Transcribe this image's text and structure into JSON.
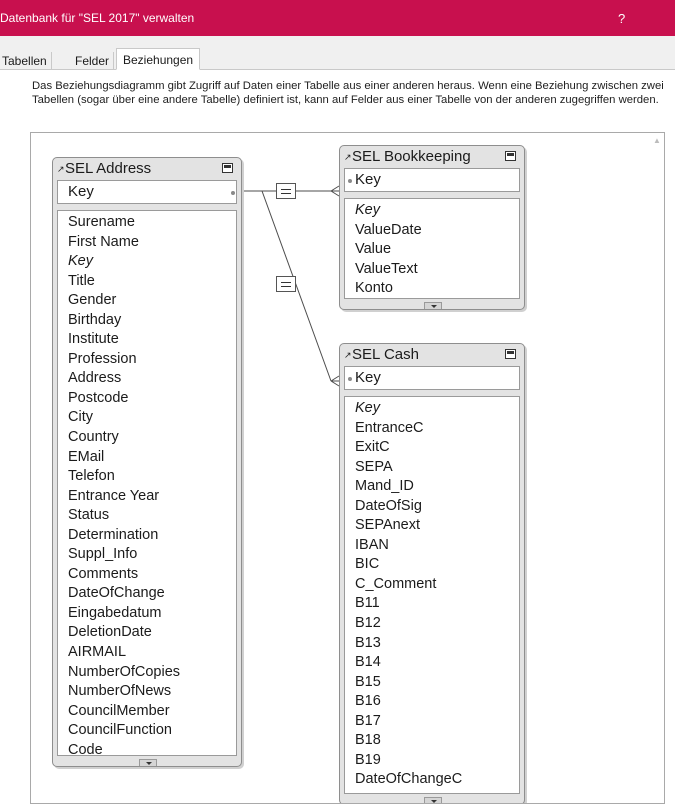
{
  "window": {
    "title": "Datenbank für \"SEL 2017\" verwalten",
    "help_label": "?"
  },
  "tabs": [
    {
      "label": "Tabellen"
    },
    {
      "label": "Felder"
    },
    {
      "label": "Beziehungen",
      "active": true
    }
  ],
  "description": "Das Beziehungsdiagramm gibt Zugriff auf Daten einer Tabelle aus einer anderen heraus. Wenn eine Beziehung zwischen zwei Tabellen (sogar über eine andere Tabelle) definiert ist, kann auf Felder aus einer Tabelle von der anderen zugegriffen werden.",
  "tables": {
    "address": {
      "name": "SEL Address",
      "key_field": "Key",
      "fields": [
        "Surename",
        "First Name",
        "Key",
        "Title",
        "Gender",
        "Birthday",
        "Institute",
        "Profession",
        "Address",
        "Postcode",
        "City",
        "Country",
        "EMail",
        "Telefon",
        "Entrance Year",
        "Status",
        "Determination",
        "Suppl_Info",
        "Comments",
        "DateOfChange",
        "Eingabedatum",
        "DeletionDate",
        "AIRMAIL",
        "NumberOfCopies",
        "NumberOfNews",
        "CouncilMember",
        "CouncilFunction",
        "Code"
      ]
    },
    "bookkeeping": {
      "name": "SEL Bookkeeping",
      "key_field": "Key",
      "fields": [
        "Key",
        "ValueDate",
        "Value",
        "ValueText",
        "Konto"
      ]
    },
    "cash": {
      "name": "SEL Cash",
      "key_field": "Key",
      "fields": [
        "Key",
        "EntranceC",
        "ExitC",
        "SEPA",
        "Mand_ID",
        "DateOfSig",
        "SEPAnext",
        "IBAN",
        "BIC",
        "C_Comment",
        "B11",
        "B12",
        "B13",
        "B14",
        "B15",
        "B16",
        "B17",
        "B18",
        "B19",
        "DateOfChangeC"
      ]
    }
  },
  "colors": {
    "titlebar": "#c8104e"
  }
}
